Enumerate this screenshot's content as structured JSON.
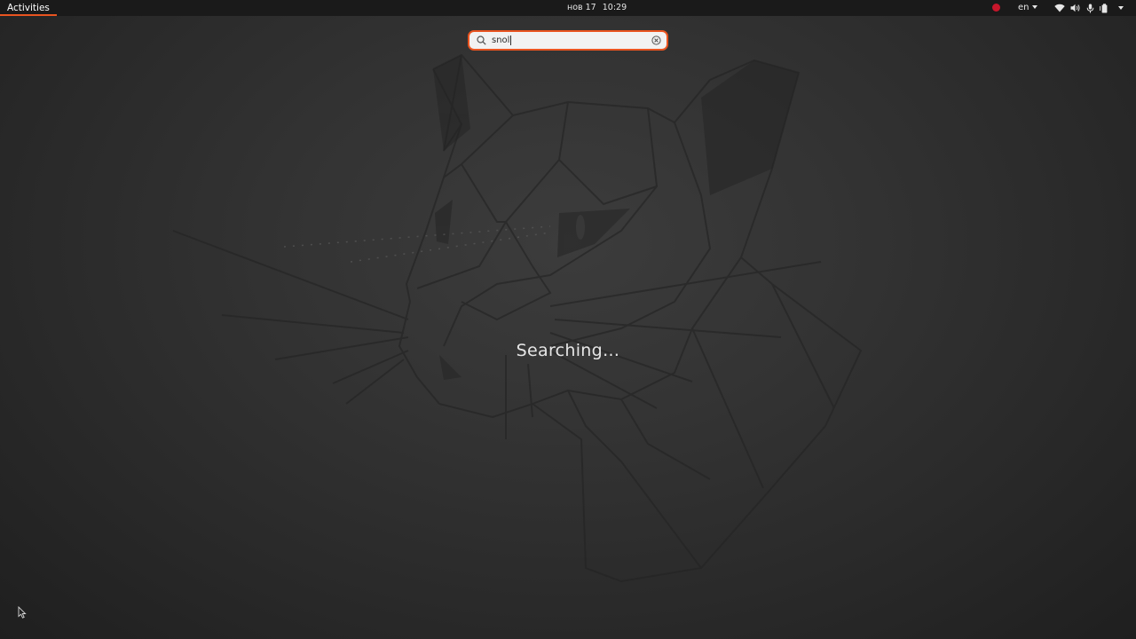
{
  "topbar": {
    "activities_label": "Activities",
    "clock_date": "нов 17",
    "clock_time": "10:29",
    "keyboard_layout": "en",
    "tray_icons": [
      "recording-indicator-icon",
      "wifi-icon",
      "volume-icon",
      "microphone-icon",
      "battery-icon",
      "chevron-down-icon"
    ]
  },
  "search": {
    "value": "snol"
  },
  "status": {
    "message": "Searching…"
  },
  "colors": {
    "accent": "#e95420",
    "topbar_bg": "#1a1a1a",
    "recording": "#c7162b"
  }
}
